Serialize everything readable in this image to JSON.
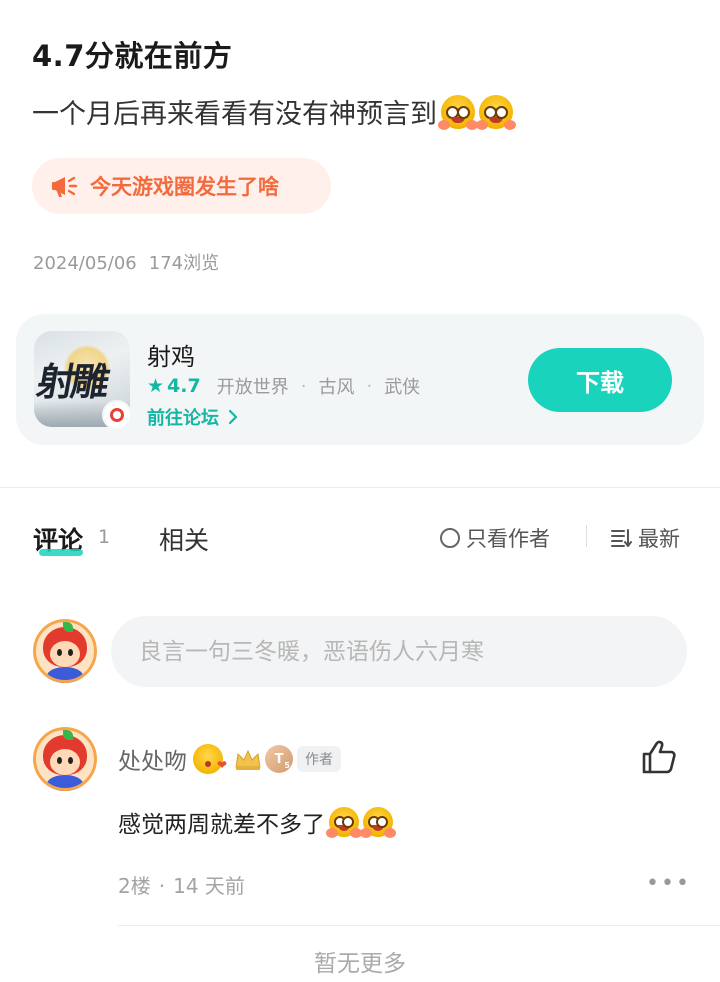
{
  "post": {
    "title": "4.7分就在前方",
    "body": "一个月后再来看看有没有神预言到",
    "topic_chip": "今天游戏圈发生了啥",
    "date": "2024/05/06",
    "views": "174浏览"
  },
  "game": {
    "icon_text": "射雕",
    "name": "射鸡",
    "rating": "4.7",
    "tags": [
      "开放世界",
      "古风",
      "武侠"
    ],
    "forum_link": "前往论坛",
    "download_label": "下载"
  },
  "tabs": {
    "comments_label": "评论",
    "comments_count": "1",
    "related_label": "相关",
    "author_only_label": "只看作者",
    "sort_label": "最新"
  },
  "composer": {
    "placeholder": "良言一句三冬暖，恶语伤人六月寒"
  },
  "comments": [
    {
      "username": "处处吻",
      "level_badge": "T",
      "level_sub": "5",
      "author_tag": "作者",
      "text": "感觉两周就差不多了",
      "floor": "2楼",
      "time": "14 天前"
    }
  ],
  "footer": {
    "no_more": "暂无更多"
  },
  "colors": {
    "accent": "#19d3bd",
    "accent_text": "#16b6a4",
    "chip_bg": "#fff0ec",
    "chip_text": "#f36b3d"
  },
  "icons": [
    "megaphone-icon",
    "star-icon",
    "chevron-right-icon",
    "radio-circle-icon",
    "sort-list-icon",
    "like-icon",
    "more-dots-icon",
    "crown-icon"
  ]
}
